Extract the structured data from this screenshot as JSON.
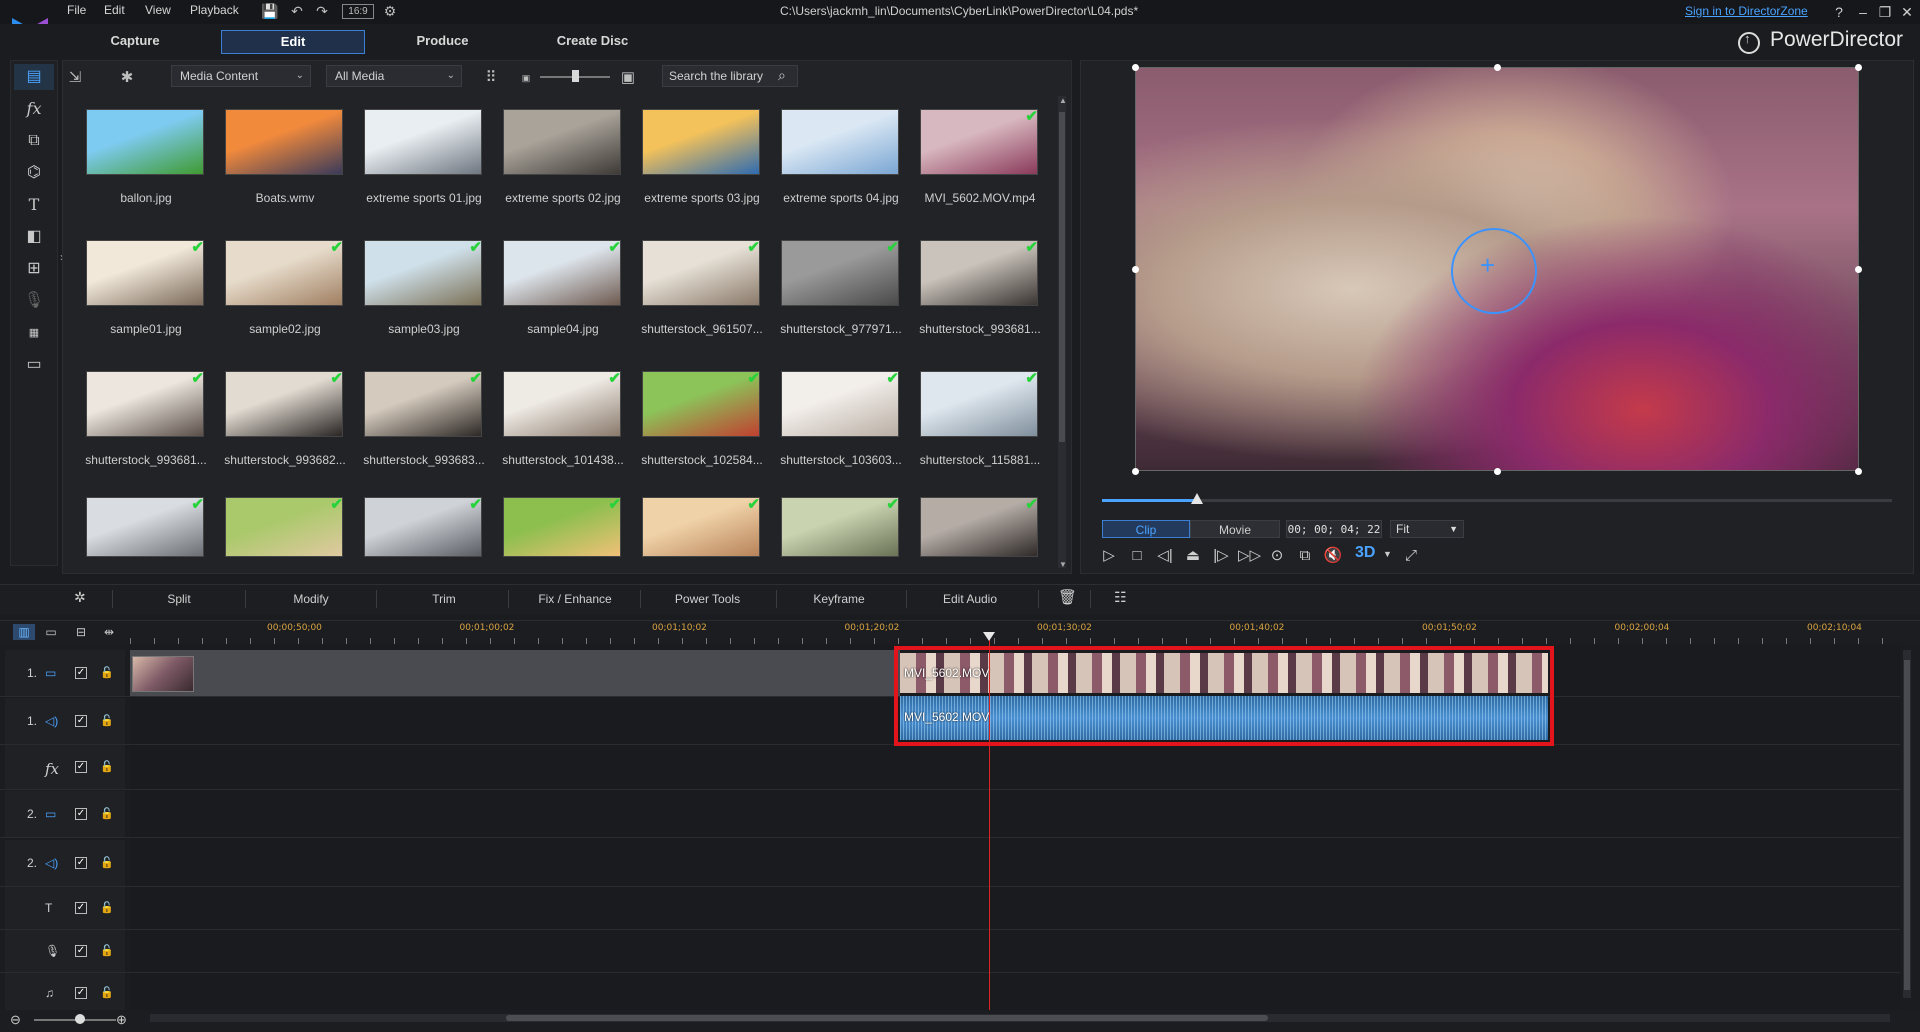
{
  "menu": [
    "File",
    "Edit",
    "View",
    "Playback"
  ],
  "toolbar": {
    "aspect": "16:9"
  },
  "file_path": "C:\\Users\\jackmh_lin\\Documents\\CyberLink\\PowerDirector\\L04.pds*",
  "sign_in": "Sign in to DirectorZone",
  "window_controls": [
    "?",
    "–",
    "❐",
    "✕"
  ],
  "tabs": [
    "Capture",
    "Edit",
    "Produce",
    "Create Disc"
  ],
  "active_tab": "Edit",
  "brand": "PowerDirector",
  "library": {
    "content_dropdown": "Media Content",
    "filter_dropdown": "All Media",
    "search_placeholder": "Search the library",
    "items": [
      {
        "name": "ballon.jpg",
        "checked": false,
        "colors": [
          "#7ecbf2",
          "#3f9a30"
        ]
      },
      {
        "name": "Boats.wmv",
        "checked": false,
        "colors": [
          "#f28a3c",
          "#3a3a5a"
        ]
      },
      {
        "name": "extreme sports 01.jpg",
        "checked": false,
        "colors": [
          "#e9eef2",
          "#6e7680"
        ]
      },
      {
        "name": "extreme sports 02.jpg",
        "checked": false,
        "colors": [
          "#a9a39a",
          "#3e3a36"
        ]
      },
      {
        "name": "extreme sports 03.jpg",
        "checked": false,
        "colors": [
          "#f4c25a",
          "#2f6bb0"
        ]
      },
      {
        "name": "extreme sports 04.jpg",
        "checked": false,
        "colors": [
          "#dbe8f4",
          "#7aa6d3"
        ]
      },
      {
        "name": "MVI_5602.MOV.mp4",
        "checked": true,
        "colors": [
          "#d8b8c0",
          "#8a3a5a"
        ]
      },
      {
        "name": "sample01.jpg",
        "checked": true,
        "colors": [
          "#f1e8da",
          "#7b6a5a"
        ]
      },
      {
        "name": "sample02.jpg",
        "checked": true,
        "colors": [
          "#e7dccb",
          "#a07f62"
        ]
      },
      {
        "name": "sample03.jpg",
        "checked": true,
        "colors": [
          "#cfe0ea",
          "#7a7056"
        ]
      },
      {
        "name": "sample04.jpg",
        "checked": true,
        "colors": [
          "#dde5ec",
          "#6e5a50"
        ]
      },
      {
        "name": "shutterstock_961507...",
        "checked": true,
        "colors": [
          "#e6e0d6",
          "#8a7a6a"
        ]
      },
      {
        "name": "shutterstock_977971...",
        "checked": true,
        "colors": [
          "#9a9a9a",
          "#4a4a4a"
        ]
      },
      {
        "name": "shutterstock_993681...",
        "checked": true,
        "colors": [
          "#c9c3bb",
          "#3a3532"
        ]
      },
      {
        "name": "shutterstock_993681...",
        "checked": true,
        "colors": [
          "#ece6df",
          "#5a4f48"
        ]
      },
      {
        "name": "shutterstock_993682...",
        "checked": true,
        "colors": [
          "#e2dbd2",
          "#2a2624"
        ]
      },
      {
        "name": "shutterstock_993683...",
        "checked": true,
        "colors": [
          "#d4cabd",
          "#2e2926"
        ]
      },
      {
        "name": "shutterstock_101438...",
        "checked": true,
        "colors": [
          "#eeeae4",
          "#8a7a6c"
        ]
      },
      {
        "name": "shutterstock_102584...",
        "checked": true,
        "colors": [
          "#8cc45a",
          "#c04030"
        ]
      },
      {
        "name": "shutterstock_103603...",
        "checked": true,
        "colors": [
          "#f2eeea",
          "#b9aea4"
        ]
      },
      {
        "name": "shutterstock_115881...",
        "checked": true,
        "colors": [
          "#dfe7ee",
          "#7f8f9c"
        ]
      },
      {
        "name": "",
        "checked": true,
        "colors": [
          "#d9dde2",
          "#6b6f74"
        ]
      },
      {
        "name": "",
        "checked": true,
        "colors": [
          "#a9c96a",
          "#e0c9a0"
        ]
      },
      {
        "name": "",
        "checked": true,
        "colors": [
          "#cfd3d8",
          "#5a5e64"
        ]
      },
      {
        "name": "",
        "checked": true,
        "colors": [
          "#8dbf4e",
          "#f0c078"
        ]
      },
      {
        "name": "",
        "checked": true,
        "colors": [
          "#f0d2a8",
          "#b8835a"
        ]
      },
      {
        "name": "",
        "checked": true,
        "colors": [
          "#c9d3b0",
          "#6a7256"
        ]
      },
      {
        "name": "",
        "checked": true,
        "colors": [
          "#b5aca6",
          "#2f2a28"
        ]
      }
    ]
  },
  "preview": {
    "modes": [
      "Clip",
      "Movie"
    ],
    "active_mode": "Clip",
    "timecode": "00; 00; 04; 22",
    "fit": "Fit",
    "progress": 0.12,
    "three_d": "3D"
  },
  "edit_tools": [
    "Split",
    "Modify",
    "Trim",
    "Fix / Enhance",
    "Power Tools",
    "Keyframe",
    "Edit Audio"
  ],
  "timeline": {
    "ruler": [
      "00;00;50;00",
      "00;01;00;02",
      "00;01;10;02",
      "00;01;20;02",
      "00;01;30;02",
      "00;01;40;02",
      "00;01;50;02",
      "00;02;00;04",
      "00;02;10;04"
    ],
    "tracks": [
      {
        "num": "1.",
        "icon": "video-track-icon",
        "glyph": "▭"
      },
      {
        "num": "1.",
        "icon": "audio-track-icon",
        "glyph": "◁)"
      },
      {
        "num": "",
        "icon": "fx-track-icon",
        "glyph": "fx"
      },
      {
        "num": "2.",
        "icon": "video-track-icon",
        "glyph": "▭"
      },
      {
        "num": "2.",
        "icon": "audio-track-icon",
        "glyph": "◁)"
      },
      {
        "num": "",
        "icon": "title-track-icon",
        "glyph": "T"
      },
      {
        "num": "",
        "icon": "voice-track-icon",
        "glyph": "🎙"
      },
      {
        "num": "",
        "icon": "music-track-icon",
        "glyph": "♫"
      }
    ],
    "video_clip_label": "MVI_5602.MOV",
    "audio_clip_label": "MVI_5602.MOV"
  },
  "colors": {
    "accent": "#4aa3ff",
    "selection": "#e3141b",
    "playhead": "#dd2222",
    "check": "#27d23a"
  }
}
